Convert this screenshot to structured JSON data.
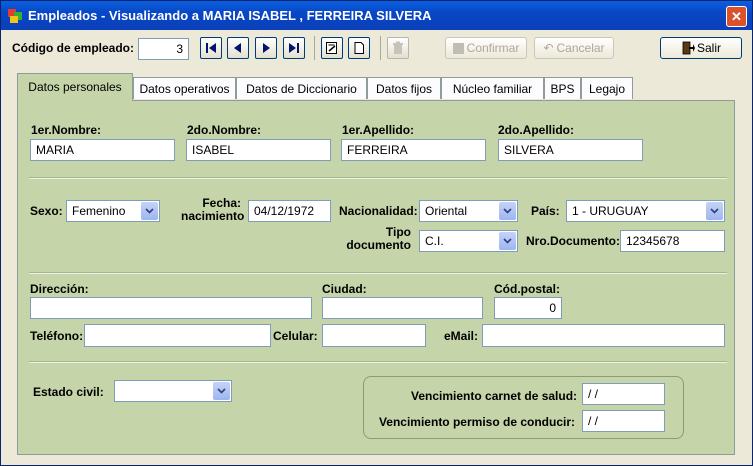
{
  "window": {
    "title": "Empleados - Visualizando a MARIA ISABEL , FERREIRA SILVERA"
  },
  "toolbar": {
    "codigo_label": "Código de empleado:",
    "codigo_value": "3",
    "confirmar_label": "Confirmar",
    "cancelar_label": "Cancelar",
    "salir_label": "Salir"
  },
  "tabs": [
    {
      "label": "Datos personales",
      "active": true
    },
    {
      "label": "Datos operativos"
    },
    {
      "label": "Datos de Diccionario"
    },
    {
      "label": "Datos fijos"
    },
    {
      "label": "Núcleo familiar"
    },
    {
      "label": "BPS"
    },
    {
      "label": "Legajo"
    }
  ],
  "names": {
    "nombre1_label": "1er.Nombre:",
    "nombre1_value": "MARIA",
    "nombre2_label": "2do.Nombre:",
    "nombre2_value": "ISABEL",
    "apellido1_label": "1er.Apellido:",
    "apellido1_value": "FERREIRA",
    "apellido2_label": "2do.Apellido:",
    "apellido2_value": "SILVERA"
  },
  "personal": {
    "sexo_label": "Sexo:",
    "sexo_value": "Femenino",
    "fecha_label_1": "Fecha:",
    "fecha_label_2": "nacimiento",
    "fecha_value": "04/12/1972",
    "nacionalidad_label": "Nacionalidad:",
    "nacionalidad_value": "Oriental",
    "pais_label": "País:",
    "pais_value": "1 - URUGUAY",
    "tipo_doc_label_1": "Tipo",
    "tipo_doc_label_2": "documento",
    "tipo_doc_value": "C.I.",
    "nro_doc_label": "Nro.Documento:",
    "nro_doc_value": "12345678"
  },
  "contact": {
    "direccion_label": "Dirección:",
    "direccion_value": "",
    "ciudad_label": "Ciudad:",
    "ciudad_value": "",
    "codpostal_label": "Cód.postal:",
    "codpostal_value": "0",
    "telefono_label": "Teléfono:",
    "telefono_value": "",
    "celular_label": "Celular:",
    "celular_value": "",
    "email_label": "eMail:",
    "email_value": ""
  },
  "other": {
    "estado_civil_label": "Estado civil:",
    "estado_civil_value": "",
    "venc_salud_label": "Vencimiento carnet de salud:",
    "venc_salud_value": "/ /",
    "venc_conducir_label": "Vencimiento permiso de conducir:",
    "venc_conducir_value": "/ /"
  },
  "icons": {
    "first": "first-record-icon",
    "prev": "prev-record-icon",
    "next": "next-record-icon",
    "last": "last-record-icon",
    "edit": "edit-icon",
    "new": "new-icon",
    "delete": "delete-icon",
    "salir": "exit-door-icon"
  }
}
